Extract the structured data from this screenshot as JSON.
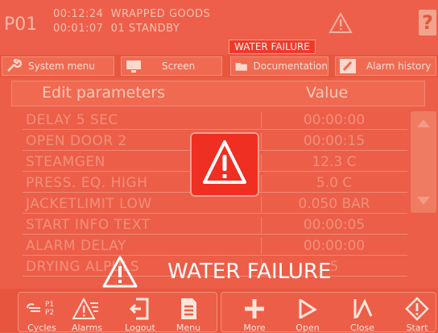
{
  "header": {
    "station_id": "P01",
    "elapsed_time": "00:12:24",
    "program_name": "WRAPPED GOODS",
    "step_time": "00:01:07",
    "step_name": "01 STANDBY",
    "alarm_badge": "WATER FAILURE",
    "help_label": "?"
  },
  "toolbar": {
    "items": [
      {
        "label": "System menu",
        "icon": "wrench-icon"
      },
      {
        "label": "Screen",
        "icon": "monitor-icon"
      },
      {
        "label": "Documentation",
        "icon": "folder-icon"
      },
      {
        "label": "Alarm history",
        "icon": "pen-icon"
      }
    ]
  },
  "table": {
    "col_name": "Edit parameters",
    "col_value": "Value",
    "rows": [
      {
        "name": "DELAY 5 SEC",
        "value": "00:00:00"
      },
      {
        "name": "OPEN DOOR 2",
        "value": "00:00:15"
      },
      {
        "name": "STEAMGEN",
        "value": "12.3 C"
      },
      {
        "name": "PRESS. EQ. HIGH",
        "value": "5.0 C"
      },
      {
        "name": "JACKETLIMIT LOW",
        "value": "0.050 BAR"
      },
      {
        "name": "START INFO TEXT",
        "value": "00:00:05"
      },
      {
        "name": "ALARM DELAY",
        "value": "00:00:00"
      },
      {
        "name": "DRYING ALPULS",
        "value": "5"
      }
    ]
  },
  "alarm_overlay": {
    "message": "WATER FAILURE",
    "icon": "warning-triangle-icon"
  },
  "bottom_bar": {
    "left_buttons": [
      {
        "label": "Cycles",
        "icon": "cycles-icon",
        "sub1": "P1",
        "sub2": "P2"
      },
      {
        "label": "Alarms",
        "icon": "alarms-icon"
      },
      {
        "label": "Logout",
        "icon": "logout-icon"
      },
      {
        "label": "Menu",
        "icon": "menu-icon"
      }
    ],
    "right_buttons": [
      {
        "label": "More",
        "icon": "plus-icon"
      },
      {
        "label": "Open",
        "icon": "open-door-icon"
      },
      {
        "label": "Close",
        "icon": "close-door-icon"
      },
      {
        "label": "Start",
        "icon": "start-icon"
      }
    ]
  },
  "colors": {
    "alarm_overlay": "#ec5e48",
    "alarm_red": "#ee2f22",
    "text_light": "#fde6dc"
  }
}
